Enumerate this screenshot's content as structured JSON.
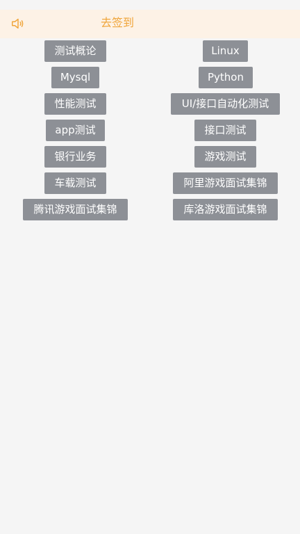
{
  "header": {
    "speaker_icon": "speaker-icon",
    "checkin_label": "去签到",
    "background": "#fdf2e6",
    "accent": "#f0a53a"
  },
  "categories": {
    "left": [
      "测试概论",
      "Mysql",
      "性能测试",
      "app测试",
      "银行业务",
      "车载测试",
      "腾讯游戏面试集锦"
    ],
    "right": [
      "Linux",
      "Python",
      "UI/接口自动化测试",
      "接口测试",
      "游戏测试",
      "阿里游戏面试集锦",
      "库洛游戏面试集锦"
    ],
    "button_color": "#8d9096"
  }
}
